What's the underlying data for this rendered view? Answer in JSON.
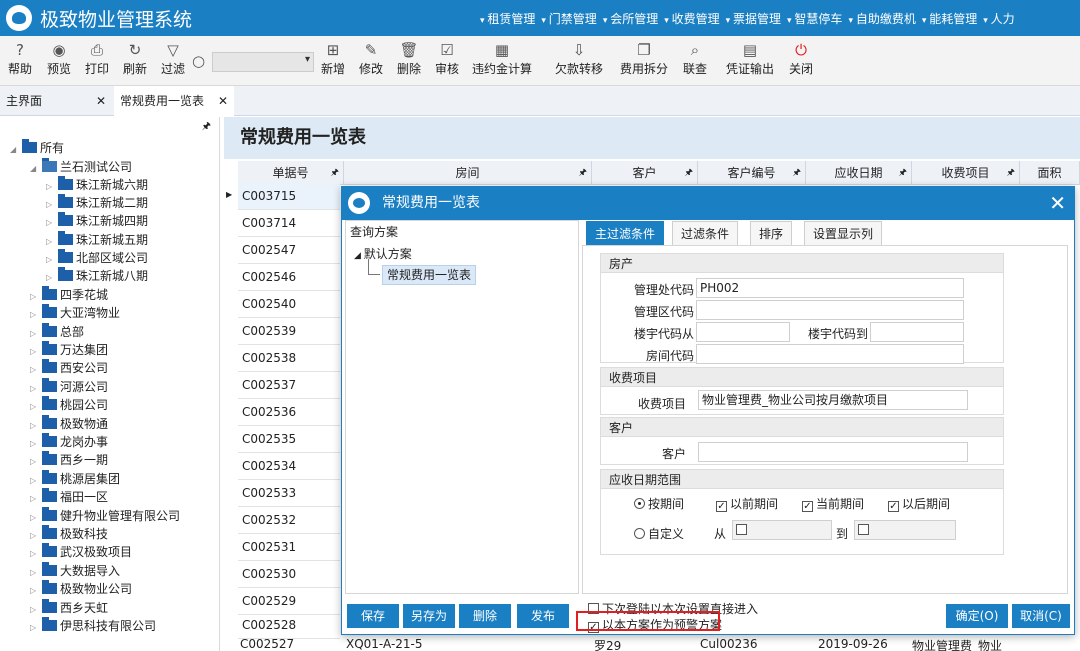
{
  "app": {
    "title": "极致物业管理系统"
  },
  "menus": [
    "租赁管理",
    "门禁管理",
    "会所管理",
    "收费管理",
    "票据管理",
    "智慧停车",
    "自助缴费机",
    "能耗管理",
    "人力"
  ],
  "toolbar": {
    "help": "帮助",
    "preview": "预览",
    "print": "打印",
    "refresh": "刷新",
    "filter": "过滤",
    "add": "新增",
    "edit": "修改",
    "delete": "删除",
    "audit": "审核",
    "penalty": "违约金计算",
    "arrears": "欠款转移",
    "split": "费用拆分",
    "link": "联查",
    "voucher": "凭证输出",
    "close": "关闭"
  },
  "tabs": {
    "home": "主界面",
    "current": "常规费用一览表"
  },
  "tree": {
    "root": "所有",
    "company": "兰石测试公司",
    "sub": [
      "珠江新城六期",
      "珠江新城二期",
      "珠江新城四期",
      "珠江新城五期",
      "北部区域公司",
      "珠江新城八期"
    ],
    "others": [
      "四季花城",
      "大亚湾物业",
      "总部",
      "万达集团",
      "西安公司",
      "河源公司",
      "桃园公司",
      "极致物通",
      "龙岗办事",
      "西乡一期",
      "桃源居集团",
      "福田一区",
      "健升物业管理有限公司",
      "极致科技",
      "武汉极致项目",
      "大数据导入",
      "极致物业公司",
      "西乡天虹",
      "伊思科技有限公司"
    ]
  },
  "main": {
    "title": "常规费用一览表",
    "columns": [
      "单据号",
      "房间",
      "客户",
      "客户编号",
      "应收日期",
      "收费项目",
      "面积"
    ],
    "rows": [
      "C003715",
      "C003714",
      "C002547",
      "C002546",
      "C002540",
      "C002539",
      "C002538",
      "C002537",
      "C002536",
      "C002535",
      "C002534",
      "C002533",
      "C002532",
      "C002531",
      "C002530",
      "C002529",
      "C002528"
    ],
    "last_row": {
      "id": "C002527",
      "room": "XQ01-A-21-5",
      "customer": "罗29",
      "code": "Cul00236",
      "date": "2019-09-26",
      "item": "物业管理费_物业"
    }
  },
  "dialog": {
    "title": "常规费用一览表",
    "plan_header": "查询方案",
    "plan_root": "默认方案",
    "plan_child": "常规费用一览表",
    "tabs": [
      "主过滤条件",
      "过滤条件",
      "排序",
      "设置显示列"
    ],
    "sections": {
      "house": "房产",
      "fee": "收费项目",
      "customer": "客户",
      "date": "应收日期范围"
    },
    "fields": {
      "mgmt_code_label": "管理处代码",
      "mgmt_code_value": "PH002",
      "area_code_label": "管理区代码",
      "bld_from_label": "楼宇代码从",
      "bld_to_label": "楼宇代码到",
      "room_code_label": "房间代码",
      "fee_item_label": "收费项目",
      "fee_item_value": "物业管理费_物业公司按月缴款项目",
      "customer_label": "客户"
    },
    "date_options": {
      "by_period": "按期间",
      "prev": "以前期间",
      "curr": "当前期间",
      "next": "以后期间",
      "custom": "自定义",
      "from": "从",
      "to": "到"
    },
    "buttons": {
      "save": "保存",
      "save_as": "另存为",
      "delete": "删除",
      "publish": "发布",
      "ok": "确定(O)",
      "cancel": "取消(C)"
    },
    "options": {
      "next_login": "下次登陆以本次设置直接进入",
      "default_plan": "以本方案作为预警方案"
    }
  }
}
